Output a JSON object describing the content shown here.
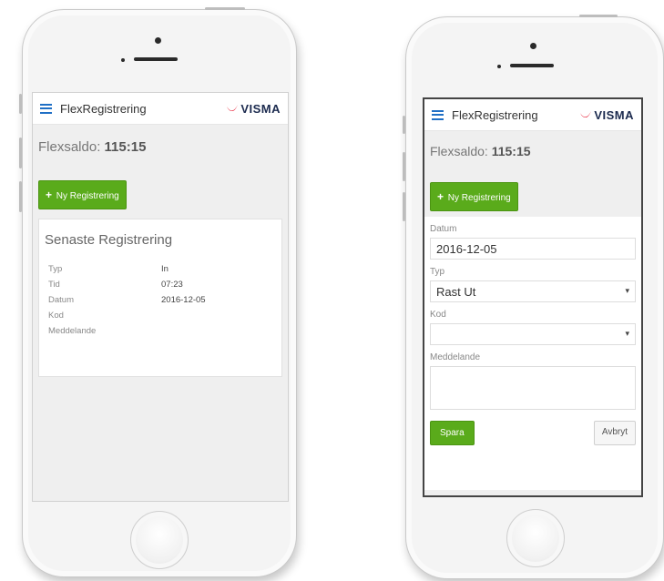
{
  "app": {
    "title": "FlexRegistrering",
    "logo": "VISMA",
    "accent_color": "#5aab1b",
    "menu_icon_color": "#1f6fc5"
  },
  "saldo": {
    "label": "Flexsaldo:",
    "value": "115:15"
  },
  "new_button": {
    "label": "Ny Registrering",
    "icon": "plus-icon"
  },
  "latest": {
    "title": "Senaste Registrering",
    "rows": [
      {
        "label": "Typ",
        "value": "In"
      },
      {
        "label": "Tid",
        "value": "07:23"
      },
      {
        "label": "Datum",
        "value": "2016-12-05"
      },
      {
        "label": "Kod",
        "value": ""
      },
      {
        "label": "Meddelande",
        "value": ""
      }
    ]
  },
  "form": {
    "datum_label": "Datum",
    "datum_value": "2016-12-05",
    "typ_label": "Typ",
    "typ_value": "Rast Ut",
    "kod_label": "Kod",
    "kod_value": "",
    "meddelande_label": "Meddelande",
    "save_label": "Spara",
    "cancel_label": "Avbryt"
  }
}
